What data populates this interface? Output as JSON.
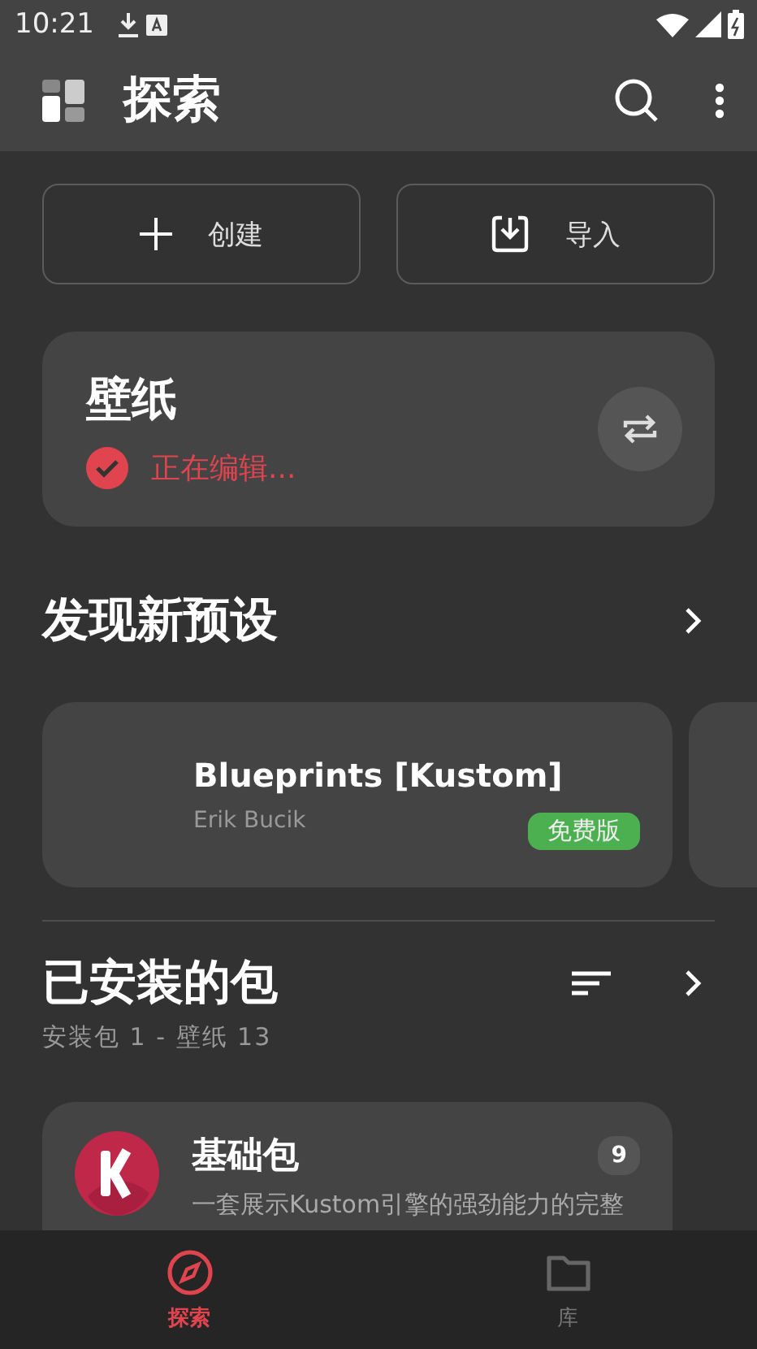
{
  "status_bar": {
    "time": "10:21"
  },
  "app_bar": {
    "title": "探索"
  },
  "actions": [
    {
      "kind": "create",
      "label": "创建"
    },
    {
      "kind": "import",
      "label": "导入"
    }
  ],
  "wallpaper_card": {
    "title": "壁纸",
    "status": "正在编辑...",
    "checked": true
  },
  "discover": {
    "title": "发现新预设",
    "presets": [
      {
        "title": "Blueprints [Kustom]",
        "author": "Erik Bucik",
        "badge": "免费版"
      }
    ]
  },
  "installed": {
    "title": "已安装的包",
    "subtitle": "安装包 1 - 壁纸 13",
    "packages": [
      {
        "name": "基础包",
        "description": "一套展示Kustom引擎的强劲能力的完整",
        "count": "9"
      }
    ]
  },
  "bottom_nav": [
    {
      "kind": "explore",
      "label": "探索",
      "selected": true
    },
    {
      "kind": "library",
      "label": "库",
      "selected": false
    }
  ]
}
